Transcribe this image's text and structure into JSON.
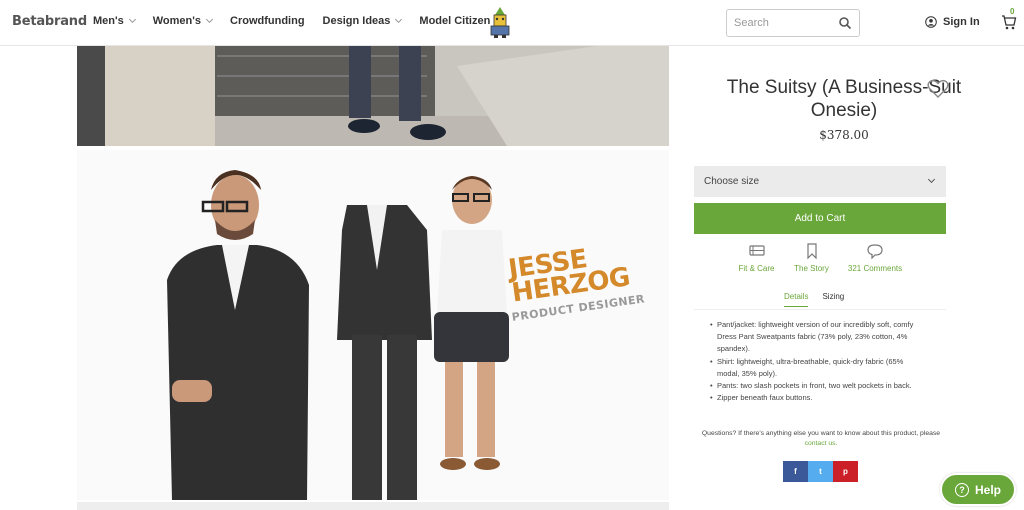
{
  "header": {
    "logo": "Betabrand",
    "nav": [
      {
        "label": "Men's",
        "dropdown": true
      },
      {
        "label": "Women's",
        "dropdown": true
      },
      {
        "label": "Crowdfunding",
        "dropdown": false
      },
      {
        "label": "Design Ideas",
        "dropdown": true
      },
      {
        "label": "Model Citizen",
        "dropdown": false
      }
    ],
    "search_placeholder": "Search",
    "signin": "Sign In",
    "cart_count": "0"
  },
  "gallery": {
    "overlay_name_line1": "JESSE",
    "overlay_name_line2": "HERZOG",
    "overlay_role": "PRODUCT DESIGNER"
  },
  "product": {
    "title": "The Suitsy (A Business-Suit Onesie)",
    "price": "$378.00",
    "size_select": "Choose size",
    "add_to_cart": "Add to Cart",
    "features": [
      {
        "label": "Fit & Care",
        "icon": "iron-icon"
      },
      {
        "label": "The Story",
        "icon": "bookmark-icon"
      },
      {
        "label": "321 Comments",
        "icon": "comment-icon"
      }
    ],
    "tabs": [
      "Details",
      "Sizing"
    ],
    "details": [
      "Pant/jacket: lightweight version of our incredibly soft, comfy Dress Pant Sweatpants fabric (73% poly, 23% cotton, 4% spandex).",
      "Shirt: lightweight, ultra-breathable, quick-dry fabric (65% modal, 35% poly).",
      "Pants: two slash pockets in front, two welt pockets in back.",
      "Zipper beneath faux buttons."
    ],
    "questions_text": "Questions? If there's anything else you want to know about this product, please",
    "contact_link": "contact us.",
    "share": {
      "facebook": "f",
      "twitter": "t",
      "pinterest": "p"
    }
  },
  "help_button": "Help",
  "colors": {
    "accent": "#6aa73a",
    "overlay_name": "#d4892a"
  }
}
